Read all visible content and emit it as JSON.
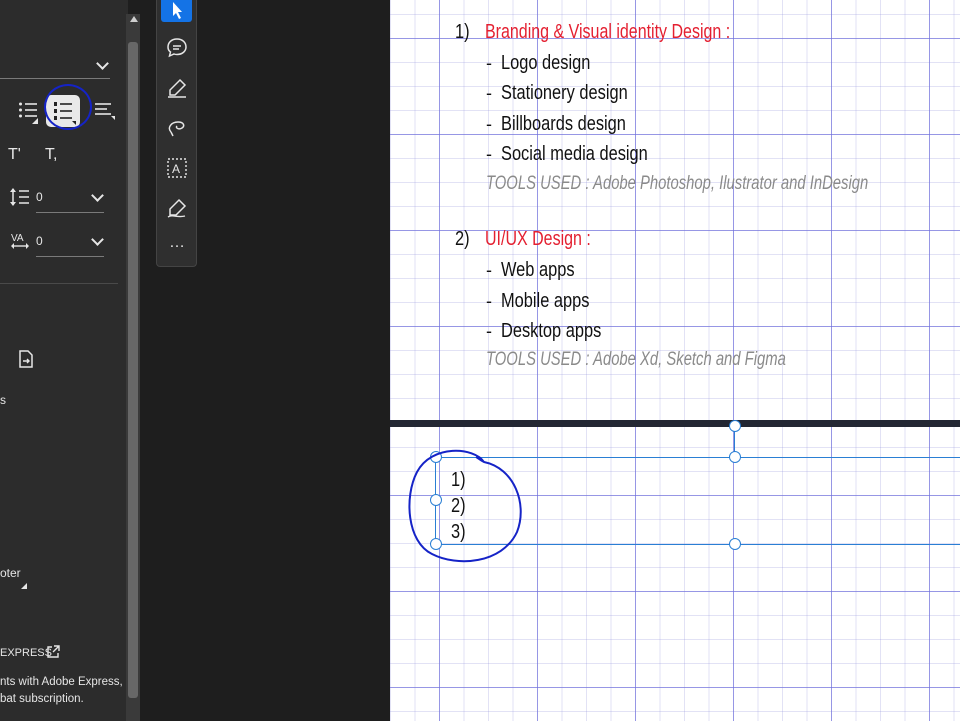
{
  "left_panel": {
    "list_button_label": "Numbered list",
    "superscript_label": "T'",
    "subscript_label": "T,",
    "line_spacing_value": "0",
    "char_spacing_value": "0",
    "item_s_fragment": "s",
    "footer_fragment": "oter",
    "express_label": "EXPRESS",
    "express_line1": "nts with Adobe Express,",
    "express_line2": "bat subscription."
  },
  "toolbar": {
    "tools": [
      "select-icon",
      "comment-icon",
      "highlight-pen-icon",
      "lasso-icon",
      "text-box-icon",
      "signature-pen-icon",
      "more-icon"
    ],
    "more_label": "…"
  },
  "document": {
    "section1": {
      "number": "1)",
      "heading": "Branding & Visual identity Design :",
      "items": [
        "Logo design",
        "Stationery design",
        "Billboards design",
        "Social media design"
      ],
      "tools": "TOOLS USED :  Adobe Photoshop, Ilustrator and InDesign"
    },
    "section2": {
      "number": "2)",
      "heading": "UI/UX Design :",
      "items": [
        "Web apps",
        "Mobile apps",
        "Desktop apps"
      ],
      "tools": "TOOLS USED : Adobe Xd, Sketch and Figma"
    },
    "bullet_dash": "-",
    "page2_list": [
      "1)",
      "2)",
      "3)"
    ]
  },
  "colors": {
    "heading_red": "#e41f30",
    "selection_blue": "#2a7fd4",
    "annotation_blue": "#1523c7",
    "active_tool_blue": "#1473e6"
  }
}
